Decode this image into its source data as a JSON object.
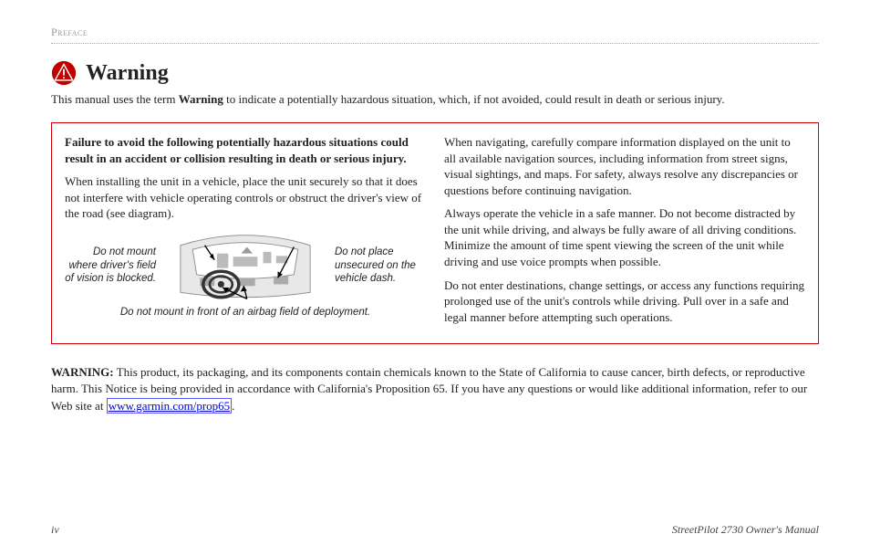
{
  "header": {
    "preface": "Preface"
  },
  "warning": {
    "title": "Warning",
    "intro_pre": "This manual uses the term ",
    "intro_bold": "Warning",
    "intro_post": " to indicate a potentially hazardous situation, which, if not avoided, could result in death or serious injury."
  },
  "box": {
    "left": {
      "bold": "Failure to avoid the following potentially hazardous situations could result in an accident or collision resulting in death or serious injury.",
      "p1": "When installing the unit in a vehicle, place the unit securely so that it does not interfere with vehicle operating controls or obstruct the driver's view of the road (see diagram).",
      "callout_left": "Do not mount where driver's field of vision is blocked.",
      "callout_right": "Do not place unsecured on the vehicle dash.",
      "airbag": "Do not mount in front of an airbag field of deployment."
    },
    "right": {
      "p1": "When navigating, carefully compare information displayed on the unit to all available navigation sources, including information from street signs, visual sightings, and maps. For safety, always resolve any discrepancies or questions before continuing navigation.",
      "p2": "Always operate the vehicle in a safe manner. Do not become distracted by the unit while driving, and always be fully aware of all driving conditions. Minimize the amount of time spent viewing the screen of the unit while driving and use voice prompts when possible.",
      "p3": "Do not enter destinations, change settings, or access any functions requiring prolonged use of the unit's controls while driving. Pull over in a safe and legal manner before attempting such operations."
    }
  },
  "prop65": {
    "label": "WARNING:",
    "text_pre": " This product, its packaging, and its components contain chemicals known to the State of California to cause cancer, birth defects, or reproductive harm. This Notice is being provided in accordance with California's Proposition 65. If you have any questions or would like additional information, refer to our Web site at ",
    "link": "www.garmin.com/prop65",
    "text_post": "."
  },
  "footer": {
    "page": "iv",
    "doc": "StreetPilot 2730 Owner's Manual"
  }
}
